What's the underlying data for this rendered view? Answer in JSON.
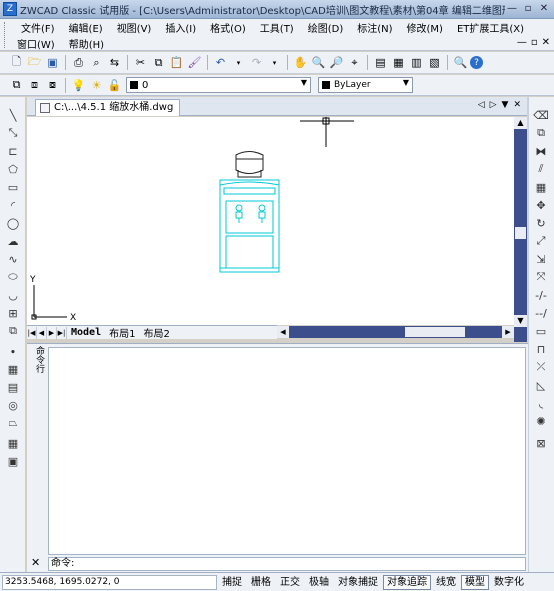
{
  "titlebar": {
    "title": "ZWCAD Classic 试用版 - [C:\\Users\\Administrator\\Desktop\\CAD培训\\图文教程\\素材\\第04章 编辑二维图形\\4.5.1 ...",
    "icon": "Z",
    "minimize": "—",
    "restore": "▫",
    "close": "✕"
  },
  "menu": {
    "row1": [
      "文件(F)",
      "编辑(E)",
      "视图(V)",
      "插入(I)",
      "格式(O)",
      "工具(T)",
      "绘图(D)",
      "标注(N)",
      "修改(M)",
      "ET扩展工具(X)"
    ],
    "row2": [
      "窗口(W)",
      "帮助(H)"
    ],
    "mdi": [
      "—",
      "▫",
      "✕"
    ]
  },
  "toolbar": {
    "layer_value": "0",
    "color_value": "ByLayer"
  },
  "document": {
    "tab_label": "C:\\...\\4.5.1  缩放水桶.dwg"
  },
  "layouts": {
    "tabs": [
      "Model",
      "布局1",
      "布局2"
    ],
    "active": "Model"
  },
  "axes": {
    "x": "X",
    "y": "Y"
  },
  "command": {
    "side_label": "命令行",
    "prompt": "命令:",
    "close": "✕"
  },
  "status": {
    "coordinates": "3253.5468,  1695.0272,  0",
    "buttons": [
      "捕捉",
      "栅格",
      "正交",
      "极轴",
      "对象捕捉",
      "对象追踪",
      "线宽",
      "模型",
      "数字化"
    ],
    "active_buttons": [
      "对象追踪",
      "模型"
    ]
  },
  "colors": {
    "accent": "#3c4f8c",
    "drawing_stroke": "#00c8d8",
    "background": "#eef2f7"
  }
}
